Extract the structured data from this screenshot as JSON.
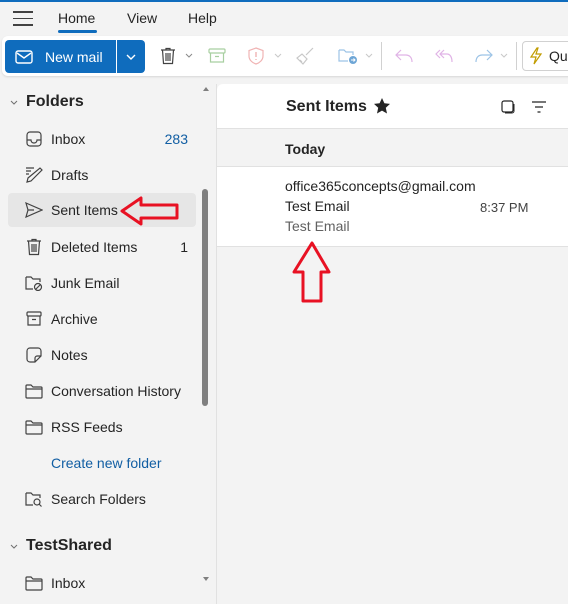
{
  "app": {
    "accent_color": "#0f6cbd",
    "annotation_color": "#e81123"
  },
  "tabs": [
    {
      "label": "Home",
      "active": true
    },
    {
      "label": "View",
      "active": false
    },
    {
      "label": "Help",
      "active": false
    }
  ],
  "ribbon": {
    "new_mail_label": "New mail",
    "quick_steps_label": "Qu",
    "icons": [
      "delete-icon",
      "archive-icon",
      "report-icon",
      "sweep-icon",
      "move-to-icon",
      "reply-icon",
      "reply-all-icon",
      "forward-icon",
      "quick-steps-icon"
    ]
  },
  "sidebar": {
    "folders_header": "Folders",
    "items": [
      {
        "label": "Inbox",
        "icon": "inbox-icon",
        "count": "283",
        "selected": false
      },
      {
        "label": "Drafts",
        "icon": "drafts-icon",
        "count": "",
        "selected": false
      },
      {
        "label": "Sent Items",
        "icon": "send-icon",
        "count": "",
        "selected": true
      },
      {
        "label": "Deleted Items",
        "icon": "delete-icon",
        "count": "1",
        "selected": false
      },
      {
        "label": "Junk Email",
        "icon": "junk-icon",
        "count": "",
        "selected": false
      },
      {
        "label": "Archive",
        "icon": "archive-icon",
        "count": "",
        "selected": false
      },
      {
        "label": "Notes",
        "icon": "note-icon",
        "count": "",
        "selected": false
      },
      {
        "label": "Conversation History",
        "icon": "folder-icon",
        "count": "",
        "selected": false
      },
      {
        "label": "RSS Feeds",
        "icon": "folder-icon",
        "count": "",
        "selected": false
      }
    ],
    "create_new_folder": "Create new folder",
    "search_folders": "Search Folders",
    "shared_header": "TestShared",
    "shared_items": [
      {
        "label": "Inbox",
        "icon": "folder-icon"
      }
    ]
  },
  "list": {
    "title": "Sent Items",
    "group_label": "Today",
    "messages": [
      {
        "from": "office365concepts@gmail.com",
        "subject": "Test Email",
        "time": "8:37 PM",
        "preview": "Test Email"
      }
    ]
  }
}
